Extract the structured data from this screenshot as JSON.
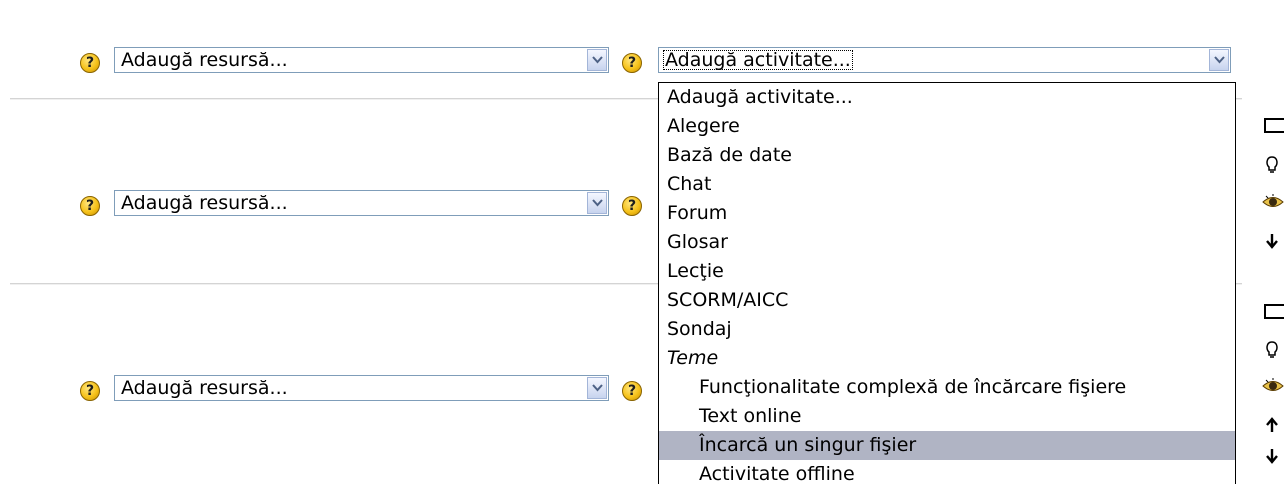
{
  "rows": [
    {
      "resource_select": "Adaugă resursă...",
      "activity_select": "Adaugă activitate..."
    },
    {
      "resource_select": "Adaugă resursă..."
    },
    {
      "resource_select": "Adaugă resursă..."
    }
  ],
  "help_glyph": "?",
  "activity_options": [
    {
      "label": "Adaugă activitate..."
    },
    {
      "label": "Alegere"
    },
    {
      "label": "Bază de date"
    },
    {
      "label": "Chat"
    },
    {
      "label": "Forum"
    },
    {
      "label": "Glosar"
    },
    {
      "label": "Lecţie"
    },
    {
      "label": "SCORM/AICC"
    },
    {
      "label": "Sondaj"
    },
    {
      "label": "Teme",
      "group": true
    },
    {
      "label": "Funcţionalitate complexă de încărcare fişiere",
      "indent": true
    },
    {
      "label": "Text online",
      "indent": true
    },
    {
      "label": "Încarcă un singur fişier",
      "indent": true,
      "highlighted": true
    },
    {
      "label": "Activitate offline",
      "indent": true
    }
  ],
  "colors": {
    "highlight": "#b0b4c4",
    "help": "#f6c21a",
    "select_border": "#7f9db9"
  },
  "side_icons_section2": [
    "select-box-icon",
    "lightbulb-icon",
    "eye-icon",
    "arrow-down-icon"
  ],
  "side_icons_section3": [
    "select-box-icon",
    "lightbulb-icon",
    "eye-icon",
    "arrow-up-icon",
    "arrow-down-icon"
  ]
}
